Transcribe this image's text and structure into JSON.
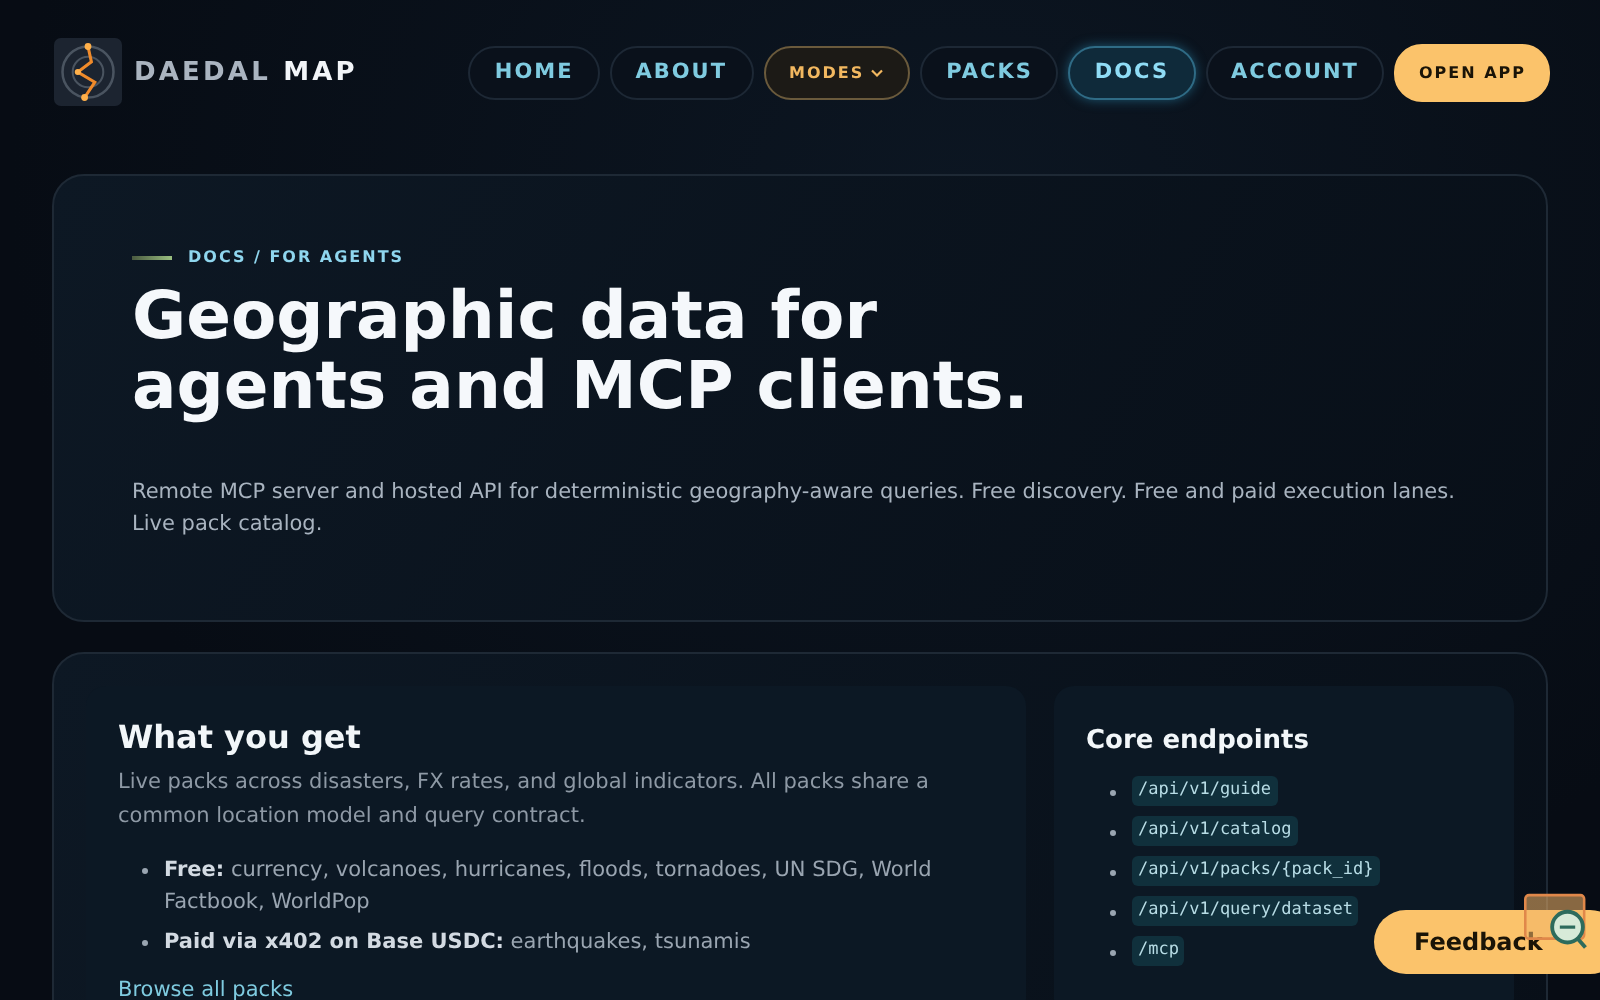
{
  "brand": {
    "primary": "DAEDAL",
    "accent": "MAP"
  },
  "nav": [
    {
      "label": "HOME",
      "kind": "link",
      "selected": false
    },
    {
      "label": "ABOUT",
      "kind": "link",
      "selected": false
    },
    {
      "label": "MODES",
      "kind": "dropdown",
      "selected": false
    },
    {
      "label": "PACKS",
      "kind": "link",
      "selected": false
    },
    {
      "label": "DOCS",
      "kind": "link",
      "selected": true
    },
    {
      "label": "ACCOUNT",
      "kind": "link",
      "selected": false
    },
    {
      "label": "OPEN APP",
      "kind": "primary",
      "selected": false
    }
  ],
  "hero": {
    "eyebrow": "DOCS / FOR AGENTS",
    "title_lines": [
      "Geographic data for",
      "agents and MCP clients."
    ],
    "lead": "Remote MCP server and hosted API for deterministic geography-aware queries. Free discovery. Free and paid execution lanes. Live pack catalog."
  },
  "what_you_get": {
    "title": "What you get",
    "intro": "Live packs across disasters, FX rates, and global indicators. All packs share a common location model and query contract.",
    "items": [
      "**Free:** currency, volcanoes, hurricanes, floods, tornadoes, UN SDG, World Factbook, WorldPop",
      "**Paid via x402 on Base USDC:** earthquakes, tsunamis"
    ],
    "link": "Browse all packs"
  },
  "core_endpoints": {
    "title": "Core endpoints",
    "items": [
      "/api/v1/guide",
      "/api/v1/catalog",
      "/api/v1/packs/{pack_id}",
      "/api/v1/query/dataset",
      "/mcp"
    ]
  },
  "feedback_button": "Feedback"
}
